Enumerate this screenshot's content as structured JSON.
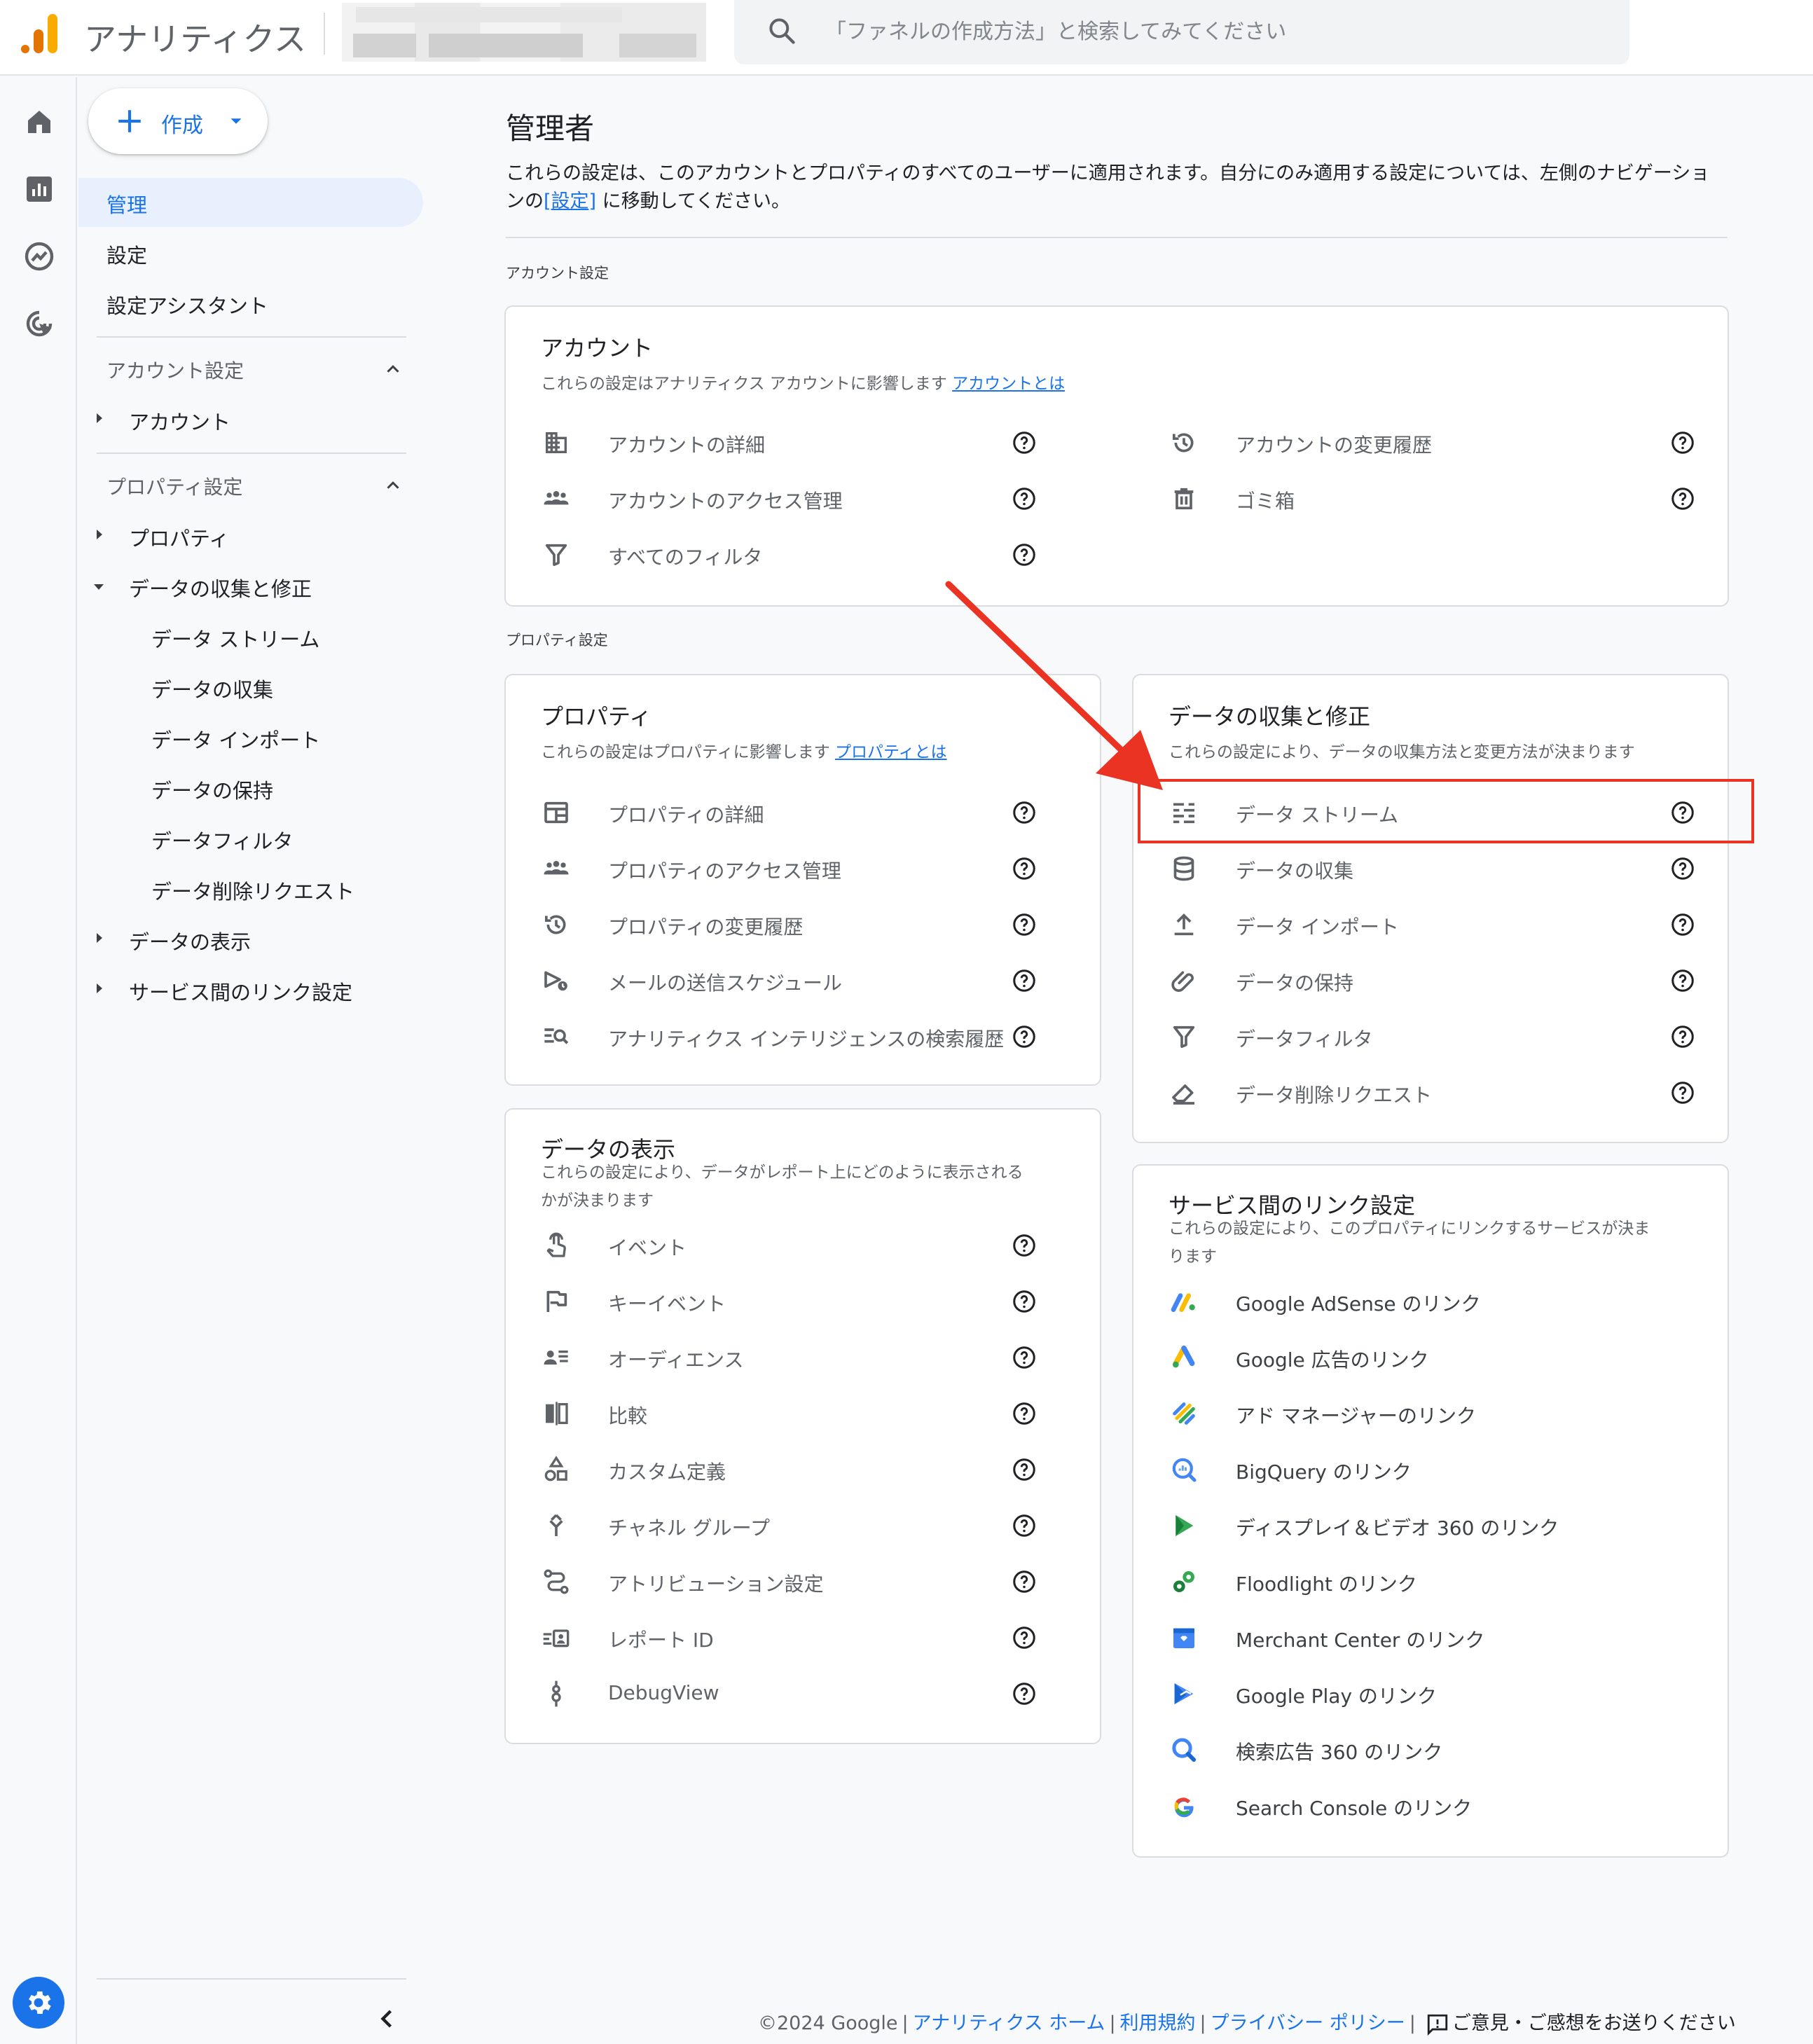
{
  "header": {
    "app_title": "アナリティクス",
    "search_placeholder": "「ファネルの作成方法」と検索してみてください"
  },
  "sidebar": {
    "create_label": "作成",
    "top_items": [
      "管理",
      "設定",
      "設定アシスタント"
    ],
    "account_section": "アカウント設定",
    "account_items": [
      "アカウント"
    ],
    "property_section": "プロパティ設定",
    "property_items": [
      "プロパティ",
      "データの収集と修正"
    ],
    "data_collection_sub": [
      "データ ストリーム",
      "データの収集",
      "データ インポート",
      "データの保持",
      "データフィルタ",
      "データ削除リクエスト"
    ],
    "property_items_after": [
      "データの表示",
      "サービス間のリンク設定"
    ]
  },
  "main": {
    "title": "管理者",
    "desc_before": "これらの設定は、このアカウントとプロパティのすべてのユーザーに適用されます。自分にのみ適用する設定については、左側のナビゲーションの",
    "desc_link": "[設定]",
    "desc_after": "に移動してください。",
    "account_section_label": "アカウント設定",
    "property_section_label": "プロパティ設定"
  },
  "account_card": {
    "title": "アカウント",
    "desc": "これらの設定はアナリティクス アカウントに影響します",
    "link": "アカウントとは",
    "left_items": [
      "アカウントの詳細",
      "アカウントのアクセス管理",
      "すべてのフィルタ"
    ],
    "right_items": [
      "アカウントの変更履歴",
      "ゴミ箱"
    ]
  },
  "property_card": {
    "title": "プロパティ",
    "desc": "これらの設定はプロパティに影響します",
    "link": "プロパティとは",
    "items": [
      "プロパティの詳細",
      "プロパティのアクセス管理",
      "プロパティの変更履歴",
      "メールの送信スケジュール",
      "アナリティクス インテリジェンスの検索履歴"
    ]
  },
  "collection_card": {
    "title": "データの収集と修正",
    "desc": "これらの設定により、データの収集方法と変更方法が決まります",
    "items": [
      "データ ストリーム",
      "データの収集",
      "データ インポート",
      "データの保持",
      "データフィルタ",
      "データ削除リクエスト"
    ]
  },
  "display_card": {
    "title": "データの表示",
    "desc1": "これらの設定により、データがレポート上にどのように表示される",
    "desc2": "かが決まります",
    "items": [
      "イベント",
      "キーイベント",
      "オーディエンス",
      "比較",
      "カスタム定義",
      "チャネル グループ",
      "アトリビューション設定",
      "レポート ID",
      "DebugView"
    ]
  },
  "links_card": {
    "title": "サービス間のリンク設定",
    "desc1": "これらの設定により、このプロパティにリンクするサービスが決ま",
    "desc2": "ります",
    "items": [
      "Google AdSense のリンク",
      "Google 広告のリンク",
      "アド マネージャーのリンク",
      "BigQuery のリンク",
      "ディスプレイ＆ビデオ 360 のリンク",
      "Floodlight のリンク",
      "Merchant Center のリンク",
      "Google Play のリンク",
      "検索広告 360 のリンク",
      "Search Console のリンク"
    ]
  },
  "footer": {
    "copyright": "©2024 Google",
    "links": [
      "アナリティクス ホーム",
      "利用規約",
      "プライバシー ポリシー"
    ],
    "feedback": "ご意見・ご感想をお送りください"
  },
  "colors": {
    "accent": "#1a73e8",
    "highlight": "#ea3323",
    "active_nav_bg": "#e8f0fe"
  }
}
